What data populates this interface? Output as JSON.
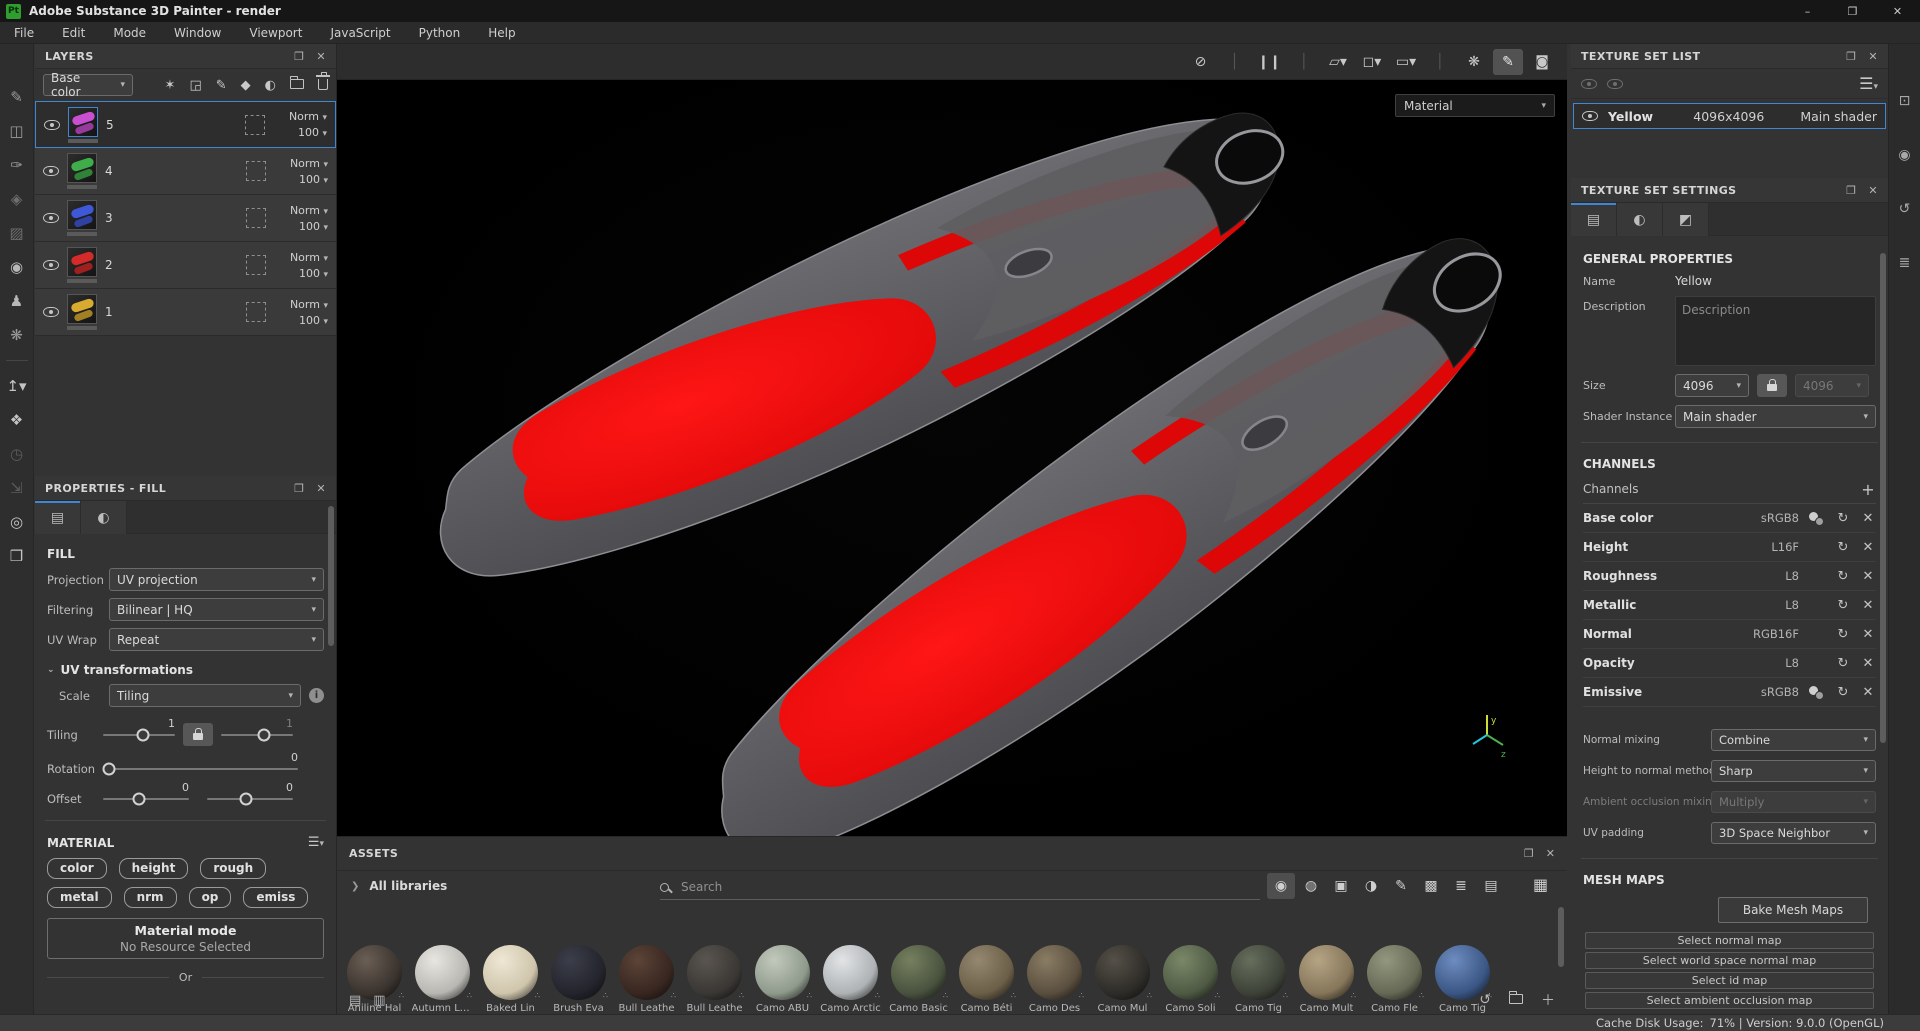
{
  "window": {
    "logo_text": "Pt",
    "title": "Adobe Substance 3D Painter - render",
    "controls": {
      "minimize": "–",
      "maximize": "❐",
      "close": "✕"
    }
  },
  "menu": {
    "items": [
      "File",
      "Edit",
      "Mode",
      "Window",
      "Viewport",
      "JavaScript",
      "Python",
      "Help"
    ]
  },
  "colors": {
    "accent": "#3f87d4",
    "fin_red": "#e00808",
    "fin_gray": "#6b6b70",
    "logo_green": "#2f9e2f"
  },
  "left_toolbar": {
    "tools_top": [
      {
        "name": "paint-tool",
        "glyph": "✎",
        "color": "#9a9a9a"
      },
      {
        "name": "eraser-tool",
        "glyph": "◫",
        "color": "#9a9a9a"
      },
      {
        "name": "projection-tool",
        "glyph": "✑",
        "color": "#9a9a9a"
      },
      {
        "name": "polygon-fill-tool",
        "glyph": "◈",
        "color": "#6e6e6e"
      },
      {
        "name": "smudge-tool",
        "glyph": "▨",
        "color": "#6e6e6e"
      },
      {
        "name": "clone-tool",
        "glyph": "◉",
        "color": "#b8b8b8"
      },
      {
        "name": "stamp-tool",
        "glyph": "♟",
        "color": "#b8b8b8"
      },
      {
        "name": "particle-tool",
        "glyph": "❋",
        "color": "#9a9a9a"
      }
    ],
    "tools_bottom": [
      {
        "name": "export-button",
        "glyph": "↥▾",
        "color": "#c4c4c4"
      },
      {
        "name": "physical-asset-tool",
        "glyph": "❖",
        "color": "#c4c4c4"
      },
      {
        "name": "hourglass-icon",
        "glyph": "◷",
        "color": "#5c5c5c"
      },
      {
        "name": "transform-icon",
        "glyph": "⇲",
        "color": "#5c5c5c"
      },
      {
        "name": "display-sphere-icon",
        "glyph": "◎",
        "color": "#c4c4c4"
      },
      {
        "name": "assets-box-icon",
        "glyph": "❒",
        "color": "#c4c4c4"
      }
    ]
  },
  "layers_panel": {
    "title": "LAYERS",
    "channel_selector": "Base color",
    "toolbar_icons": [
      {
        "name": "add-effect-icon",
        "glyph": "✶"
      },
      {
        "name": "add-fill-layer-icon",
        "glyph": "◲"
      },
      {
        "name": "add-paint-layer-icon",
        "glyph": "✎"
      },
      {
        "name": "add-smart-material-icon",
        "glyph": "◆"
      },
      {
        "name": "add-mask-icon",
        "glyph": "◐"
      }
    ],
    "items": [
      {
        "name": "5",
        "blend": "Norm",
        "opacity": "100",
        "color": "#c84fd0"
      },
      {
        "name": "4",
        "blend": "Norm",
        "opacity": "100",
        "color": "#3fae4a"
      },
      {
        "name": "3",
        "blend": "Norm",
        "opacity": "100",
        "color": "#3f58d8"
      },
      {
        "name": "2",
        "blend": "Norm",
        "opacity": "100",
        "color": "#d42a2a"
      },
      {
        "name": "1",
        "blend": "Norm",
        "opacity": "100",
        "color": "#d8aa2f"
      }
    ]
  },
  "properties_panel": {
    "title": "PROPERTIES - FILL",
    "section_title": "FILL",
    "projection_label": "Projection",
    "projection_value": "UV projection",
    "filtering_label": "Filtering",
    "filtering_value": "Bilinear | HQ",
    "uv_wrap_label": "UV Wrap",
    "uv_wrap_value": "Repeat",
    "uv_transform_title": "UV transformations",
    "scale_label": "Scale",
    "scale_value": "Tiling",
    "tiling_label": "Tiling",
    "tiling_x": "1",
    "tiling_y": "1",
    "rotation_label": "Rotation",
    "rotation_value": "0",
    "offset_label": "Offset",
    "offset_x": "0",
    "offset_y": "0",
    "material_title": "MATERIAL",
    "channel_buttons": [
      "color",
      "height",
      "rough",
      "metal",
      "nrm",
      "op",
      "emiss"
    ],
    "mode_title": "Material mode",
    "mode_subtitle": "No Resource Selected",
    "or_label": "Or"
  },
  "viewport": {
    "shading_mode": "Material",
    "toolbar": [
      {
        "name": "deselect-icon",
        "glyph": "⊘",
        "color": "#c8c8c8",
        "bg": ""
      },
      {
        "name": "divider",
        "glyph": "│",
        "color": "#555",
        "bg": ""
      },
      {
        "name": "pause-icon",
        "glyph": "❙❙",
        "color": "#c8c8c8",
        "bg": ""
      },
      {
        "name": "divider",
        "glyph": "│",
        "color": "#555",
        "bg": ""
      },
      {
        "name": "perspective-icon",
        "glyph": "▱▾",
        "color": "#c8c8c8",
        "bg": ""
      },
      {
        "name": "geometry-icon",
        "glyph": "◻▾",
        "color": "#c8c8c8",
        "bg": ""
      },
      {
        "name": "camera-icon",
        "glyph": "▭▾",
        "color": "#c8c8c8",
        "bg": ""
      },
      {
        "name": "divider",
        "glyph": "│",
        "color": "#555",
        "bg": ""
      },
      {
        "name": "particles-icon",
        "glyph": "❋",
        "color": "#c8c8c8",
        "bg": ""
      },
      {
        "name": "paint-mode-icon",
        "glyph": "✎",
        "color": "#e8e8e8",
        "bg": "#525252"
      },
      {
        "name": "snapshot-icon",
        "glyph": "◙",
        "color": "#c8c8c8",
        "bg": ""
      }
    ]
  },
  "assets_panel": {
    "title": "ASSETS",
    "breadcrumb": "All libraries",
    "search_placeholder": "Search",
    "filters": [
      {
        "name": "filter-materials-icon",
        "glyph": "◉",
        "bg": "#4e4e4e"
      },
      {
        "name": "filter-smart-materials-icon",
        "glyph": "◍",
        "bg": ""
      },
      {
        "name": "filter-smart-masks-icon",
        "glyph": "▣",
        "bg": ""
      },
      {
        "name": "filter-filters-icon",
        "glyph": "◑",
        "bg": ""
      },
      {
        "name": "filter-brushes-icon",
        "glyph": "✎",
        "bg": ""
      },
      {
        "name": "filter-alphas-icon",
        "glyph": "▩",
        "bg": ""
      },
      {
        "name": "filter-textures-icon",
        "glyph": "≣",
        "bg": ""
      },
      {
        "name": "filter-environments-icon",
        "glyph": "▤",
        "bg": ""
      }
    ],
    "grid_icon": "▦",
    "items": [
      {
        "name": "Aniline Hal",
        "c1": "#3a332e",
        "c2": "#6b5f55"
      },
      {
        "name": "Autumn Leaf",
        "c1": "#b9b7b2",
        "c2": "#e8e6e0"
      },
      {
        "name": "Baked Lin",
        "c1": "#cfc5ac",
        "c2": "#eee7d4"
      },
      {
        "name": "Brush Eva",
        "c1": "#23242c",
        "c2": "#3c3e4a"
      },
      {
        "name": "Bull Leathe",
        "c1": "#382620",
        "c2": "#5c4438"
      },
      {
        "name": "Bull Leathe",
        "c1": "#3a3734",
        "c2": "#5a5550"
      },
      {
        "name": "Camo ABU",
        "c1": "#8f9a8c",
        "c2": "#c2c9bc"
      },
      {
        "name": "Camo Arctic",
        "c1": "#aeb2b4",
        "c2": "#e2e4e6"
      },
      {
        "name": "Camo Basic",
        "c1": "#49523e",
        "c2": "#76805f"
      },
      {
        "name": "Camo Béti",
        "c1": "#6b5f48",
        "c2": "#958870"
      },
      {
        "name": "Camo Des",
        "c1": "#5a4f3f",
        "c2": "#8a7c64"
      },
      {
        "name": "Camo Mul",
        "c1": "#2e2c28",
        "c2": "#555048"
      },
      {
        "name": "Camo Soli",
        "c1": "#4f5a44",
        "c2": "#7a8868"
      },
      {
        "name": "Camo Tig",
        "c1": "#3d4238",
        "c2": "#676e5c"
      },
      {
        "name": "Camo Mult",
        "c1": "#86765a",
        "c2": "#b5a484"
      },
      {
        "name": "Camo Fle",
        "c1": "#666955",
        "c2": "#94977e"
      },
      {
        "name": "Camo Tig",
        "c1": "#3a5684",
        "c2": "#6e8cc0"
      }
    ]
  },
  "texture_set_list": {
    "title": "TEXTURE SET LIST",
    "row": {
      "name": "Yellow",
      "resolution": "4096x4096",
      "shader": "Main shader"
    }
  },
  "texture_set_settings": {
    "title": "TEXTURE SET SETTINGS",
    "general": {
      "title": "GENERAL PROPERTIES",
      "name_label": "Name",
      "name_value": "Yellow",
      "description_label": "Description",
      "description_placeholder": "Description",
      "size_label": "Size",
      "size_w": "4096",
      "size_h": "4096",
      "shader_label": "Shader Instance",
      "shader_value": "Main shader"
    },
    "channels": {
      "title": "CHANNELS",
      "list_label": "Channels",
      "add_icon": "+",
      "items": [
        {
          "name": "Base color",
          "format": "sRGB8"
        },
        {
          "name": "Height",
          "format": "L16F"
        },
        {
          "name": "Roughness",
          "format": "L8"
        },
        {
          "name": "Metallic",
          "format": "L8"
        },
        {
          "name": "Normal",
          "format": "RGB16F"
        },
        {
          "name": "Opacity",
          "format": "L8"
        },
        {
          "name": "Emissive",
          "format": "sRGB8"
        }
      ]
    },
    "mixing": {
      "normal_label": "Normal mixing",
      "normal_value": "Combine",
      "height_label": "Height to normal method",
      "height_value": "Sharp",
      "ao_label": "Ambient occlusion mixing",
      "ao_value": "Multiply",
      "uv_label": "UV padding",
      "uv_value": "3D Space Neighbor"
    },
    "mesh_maps": {
      "title": "MESH MAPS",
      "bake_button": "Bake Mesh Maps",
      "buttons": [
        "Select normal map",
        "Select world space normal map",
        "Select id map",
        "Select ambient occlusion map"
      ]
    }
  },
  "right_rail": {
    "icons": [
      {
        "name": "display-settings-icon",
        "glyph": "⊡"
      },
      {
        "name": "shader-settings-icon",
        "glyph": "◉"
      },
      {
        "name": "history-icon",
        "glyph": "↺"
      },
      {
        "name": "log-icon",
        "glyph": "≣"
      }
    ]
  },
  "status_bar": {
    "label": "Cache Disk Usage:",
    "value": "71% | Version: 9.0.0 (OpenGL)"
  }
}
